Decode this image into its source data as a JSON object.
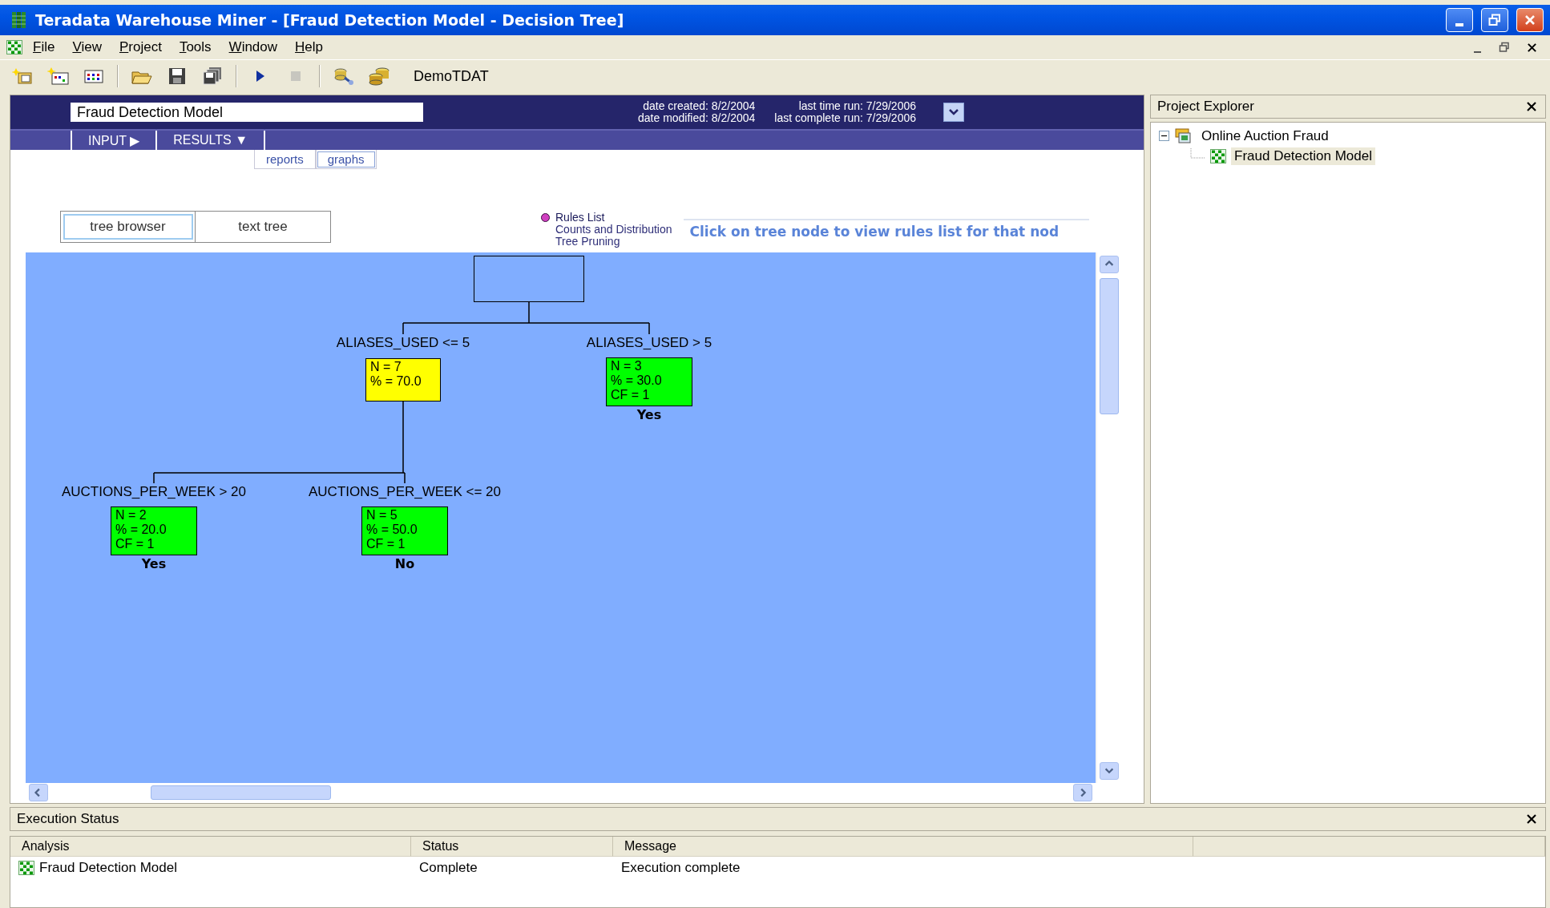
{
  "window": {
    "title": "Teradata Warehouse Miner - [Fraud Detection Model - Decision Tree]"
  },
  "menu": [
    "File",
    "View",
    "Project",
    "Tools",
    "Window",
    "Help"
  ],
  "toolbar": {
    "buttons": [
      {
        "kind": "new-project",
        "disabled": false
      },
      {
        "kind": "new-analysis",
        "disabled": false
      },
      {
        "kind": "grid",
        "disabled": false
      },
      {
        "kind": "open",
        "disabled": false
      },
      {
        "kind": "save",
        "disabled": false
      },
      {
        "kind": "save-all",
        "disabled": false
      },
      {
        "kind": "run",
        "disabled": false
      },
      {
        "kind": "stop",
        "disabled": true
      },
      {
        "kind": "connect",
        "disabled": false
      },
      {
        "kind": "database",
        "disabled": false
      }
    ],
    "connection": "DemoTDAT"
  },
  "document": {
    "model_name": "Fraud Detection Model",
    "dates_left": [
      "date created: 8/2/2004",
      "date modified: 8/2/2004"
    ],
    "dates_right": [
      "last time run: 7/29/2006",
      "last complete run: 7/29/2006"
    ],
    "nav": [
      "INPUT ▶",
      "RESULTS ▼"
    ],
    "subtabs": [
      {
        "label": "reports",
        "selected": false
      },
      {
        "label": "graphs",
        "selected": true
      }
    ],
    "view_tabs": [
      {
        "label": "tree browser",
        "selected": true
      },
      {
        "label": "text tree",
        "selected": false
      }
    ],
    "options": [
      {
        "label": "Rules List",
        "selected": true
      },
      {
        "label": "Counts and Distribution",
        "selected": false
      },
      {
        "label": "Tree Pruning",
        "selected": false
      }
    ],
    "hint": "Click on tree node to view rules list for that nod",
    "tree": {
      "children": [
        {
          "condition": "ALIASES_USED <= 5",
          "lines": [
            "N = 7",
            "% = 70.0"
          ],
          "color": "#ffff00",
          "children": [
            {
              "condition": "AUCTIONS_PER_WEEK > 20",
              "lines": [
                "N = 2",
                "% = 20.0",
                "CF = 1"
              ],
              "outcome": "Yes",
              "color": "#00ff00"
            },
            {
              "condition": "AUCTIONS_PER_WEEK <= 20",
              "lines": [
                "N = 5",
                "% = 50.0",
                "CF = 1"
              ],
              "outcome": "No",
              "color": "#00ff00"
            }
          ]
        },
        {
          "condition": "ALIASES_USED > 5",
          "lines": [
            "N = 3",
            "% = 30.0",
            "CF = 1"
          ],
          "outcome": "Yes",
          "color": "#00ff00"
        }
      ]
    }
  },
  "project_explorer": {
    "title": "Project Explorer",
    "items": [
      {
        "label": "Online Auction Fraud",
        "expanded": true,
        "selected": false,
        "children": [
          {
            "label": "Fraud Detection Model",
            "selected": true
          }
        ]
      }
    ]
  },
  "execution_status": {
    "title": "Execution Status",
    "columns": [
      "Analysis",
      "Status",
      "Message"
    ],
    "rows": [
      [
        "Fraud Detection Model",
        "Complete",
        "Execution complete"
      ]
    ]
  }
}
